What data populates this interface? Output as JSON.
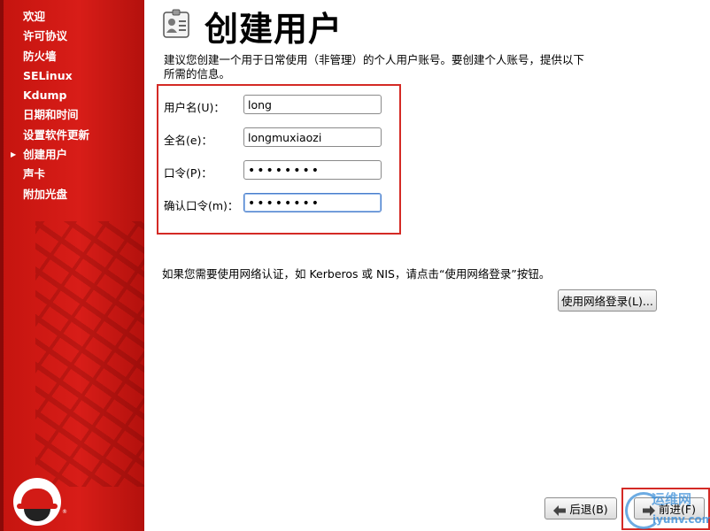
{
  "sidebar": {
    "items": [
      {
        "label": "欢迎"
      },
      {
        "label": "许可协议"
      },
      {
        "label": "防火墙"
      },
      {
        "label": "SELinux"
      },
      {
        "label": "Kdump"
      },
      {
        "label": "日期和时间"
      },
      {
        "label": "设置软件更新"
      },
      {
        "label": "创建用户",
        "current": true
      },
      {
        "label": "声卡"
      },
      {
        "label": "附加光盘"
      }
    ]
  },
  "header": {
    "title": "创建用户",
    "icon": "id-badge-icon"
  },
  "description": [
    "建议您创建一个用于日常使用（非管理）的个人用户账号。要创建个人账号，提供以下",
    "所需的信息。"
  ],
  "form": {
    "username": {
      "label": "用户名(U)：",
      "value": "long"
    },
    "fullname": {
      "label": "全名(e)：",
      "value": "longmuxiaozi"
    },
    "password": {
      "label": "口令(P)：",
      "value": "••••••••"
    },
    "confirm": {
      "label": "确认口令(m)：",
      "value": "••••••••"
    }
  },
  "network": {
    "text": "如果您需要使用网络认证，如 Kerberos 或 NIS，请点击“使用网络登录”按钮。",
    "button": "使用网络登录(L)..."
  },
  "footer": {
    "back": "后退(B)",
    "next": "前进(F)"
  },
  "watermark": {
    "line1": "运维网",
    "line2": "iyunv.com"
  },
  "colors": {
    "sidebar": "#d21b16",
    "highlight_box": "#d42a25",
    "focus": "#4a7ecb"
  }
}
